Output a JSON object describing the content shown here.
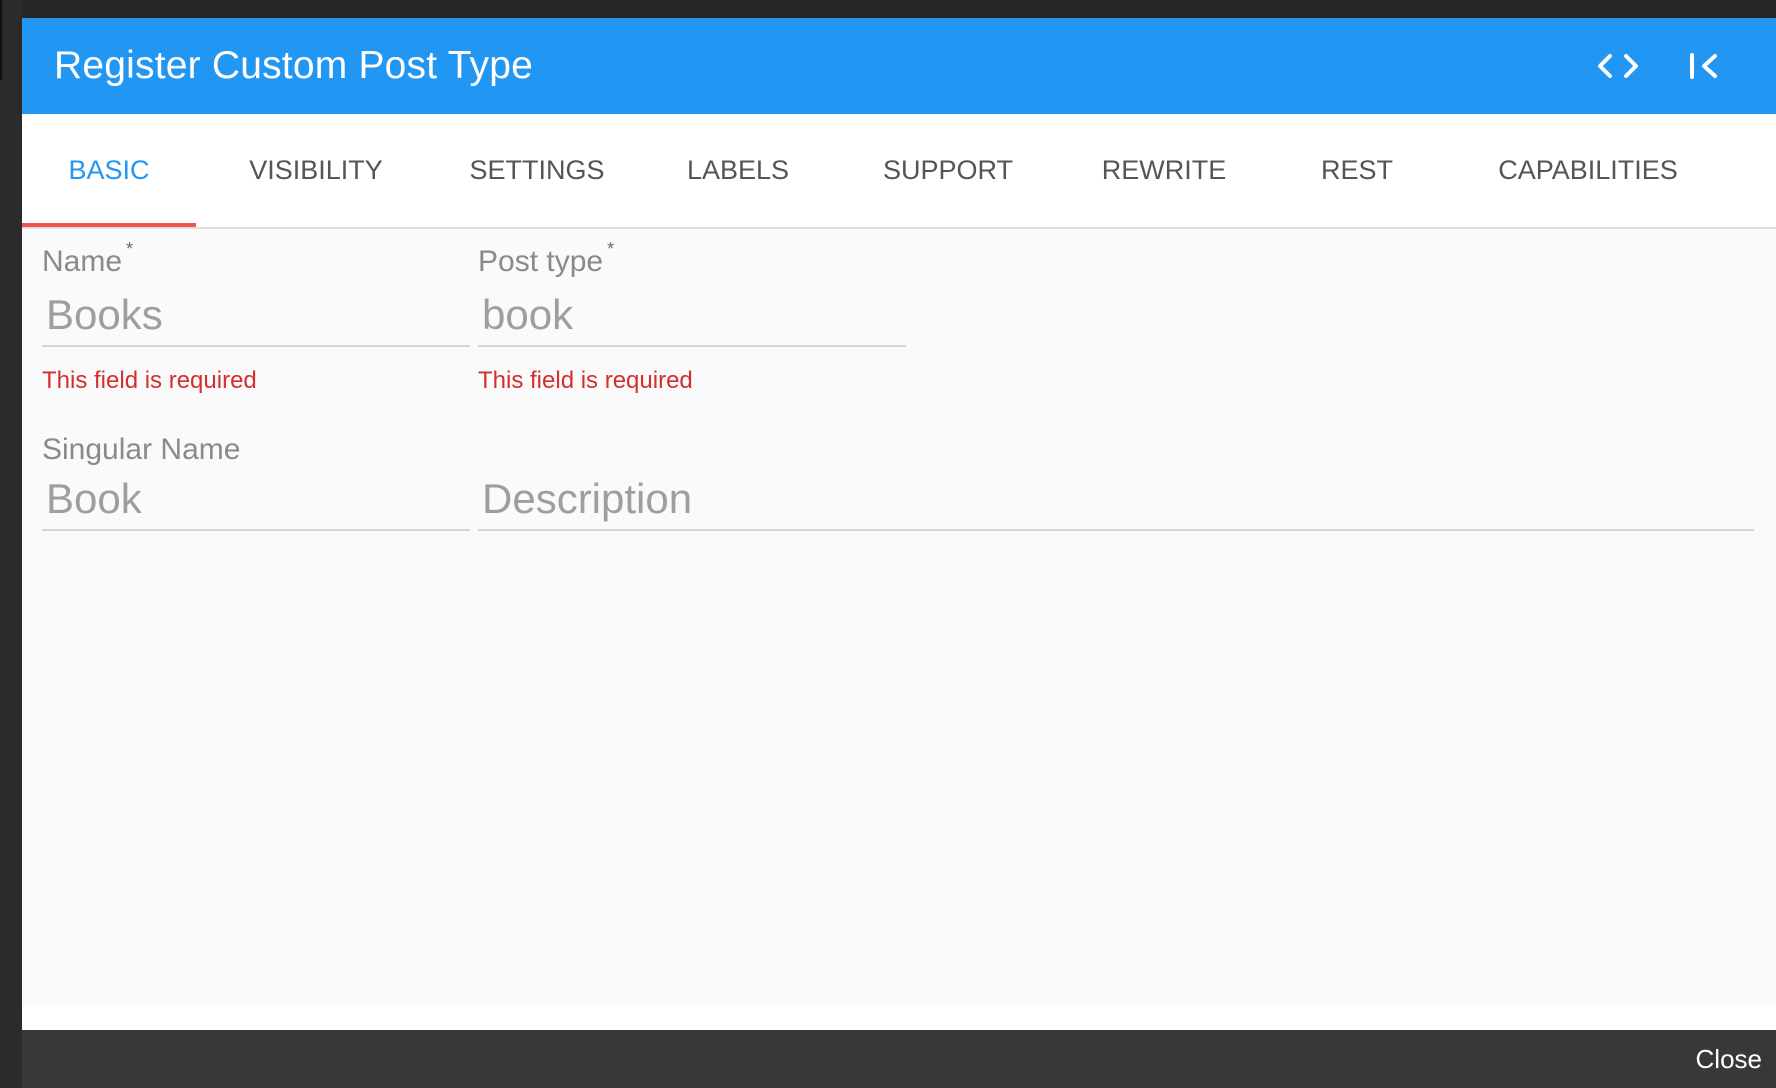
{
  "modal": {
    "title": "Register Custom Post Type",
    "icons": {
      "code": "code-brackets-icon",
      "collapse": "collapse-left-icon"
    }
  },
  "tabs": [
    {
      "label": "BASIC",
      "active": true
    },
    {
      "label": "VISIBILITY",
      "active": false
    },
    {
      "label": "SETTINGS",
      "active": false
    },
    {
      "label": "LABELS",
      "active": false
    },
    {
      "label": "SUPPORT",
      "active": false
    },
    {
      "label": "REWRITE",
      "active": false
    },
    {
      "label": "REST",
      "active": false
    },
    {
      "label": "CAPABILITIES",
      "active": false
    }
  ],
  "form": {
    "name": {
      "label": "Name",
      "required_mark": "*",
      "placeholder": "Books",
      "value": "",
      "error": "This field is required"
    },
    "post_type": {
      "label": "Post type",
      "required_mark": "*",
      "placeholder": "book",
      "value": "",
      "error": "This field is required"
    },
    "singular_name": {
      "label": "Singular Name",
      "placeholder": "Book",
      "value": ""
    },
    "description": {
      "placeholder": "Description",
      "value": ""
    }
  },
  "footer": {
    "close_label": "Close"
  },
  "colors": {
    "header": "#2196f3",
    "tab_active": "#2196f3",
    "tab_indicator": "#ef5350",
    "error": "#d32f2f",
    "footer": "#383838"
  }
}
